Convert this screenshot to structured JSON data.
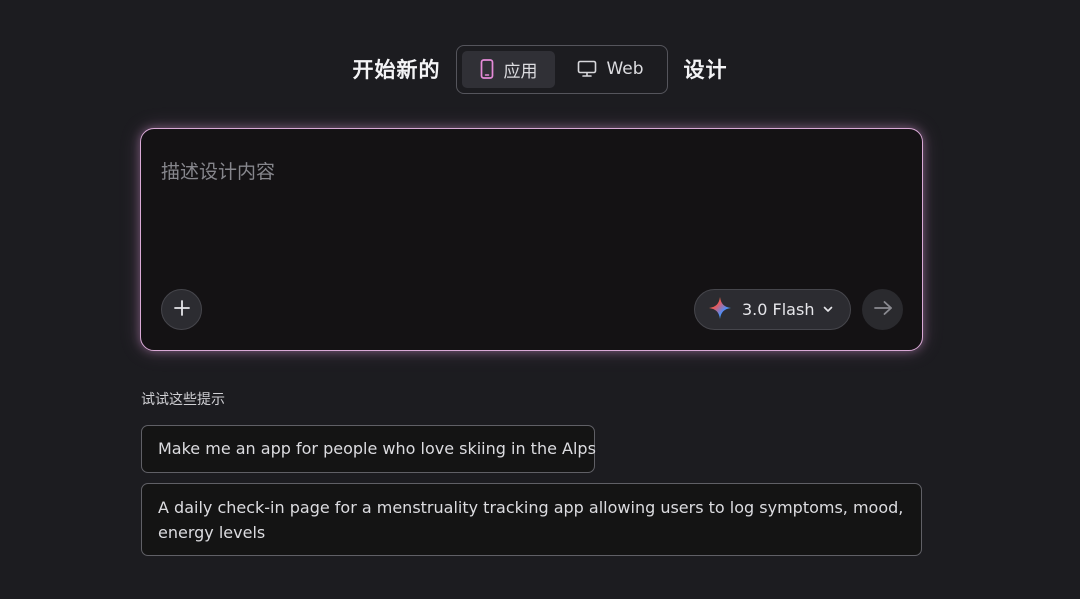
{
  "header": {
    "prefix": "开始新的",
    "suffix": "设计",
    "modes": [
      {
        "label": "应用",
        "icon": "phone-icon",
        "active": true
      },
      {
        "label": "Web",
        "icon": "monitor-icon",
        "active": false
      }
    ]
  },
  "prompt": {
    "placeholder": "描述设计内容",
    "value": ""
  },
  "model": {
    "label": "3.0 Flash",
    "icon": "sparkle-icon"
  },
  "suggestions": {
    "title": "试试这些提示",
    "items": [
      "Make me an app for people who love skiing in the Alps",
      "A daily check-in page for a menstruality tracking app allowing users to log symptoms, mood, energy levels"
    ]
  },
  "colors": {
    "background": "#1c1c20",
    "prompt_glow": "#d9a9d6",
    "active_tab_icon": "#e58ad8"
  }
}
